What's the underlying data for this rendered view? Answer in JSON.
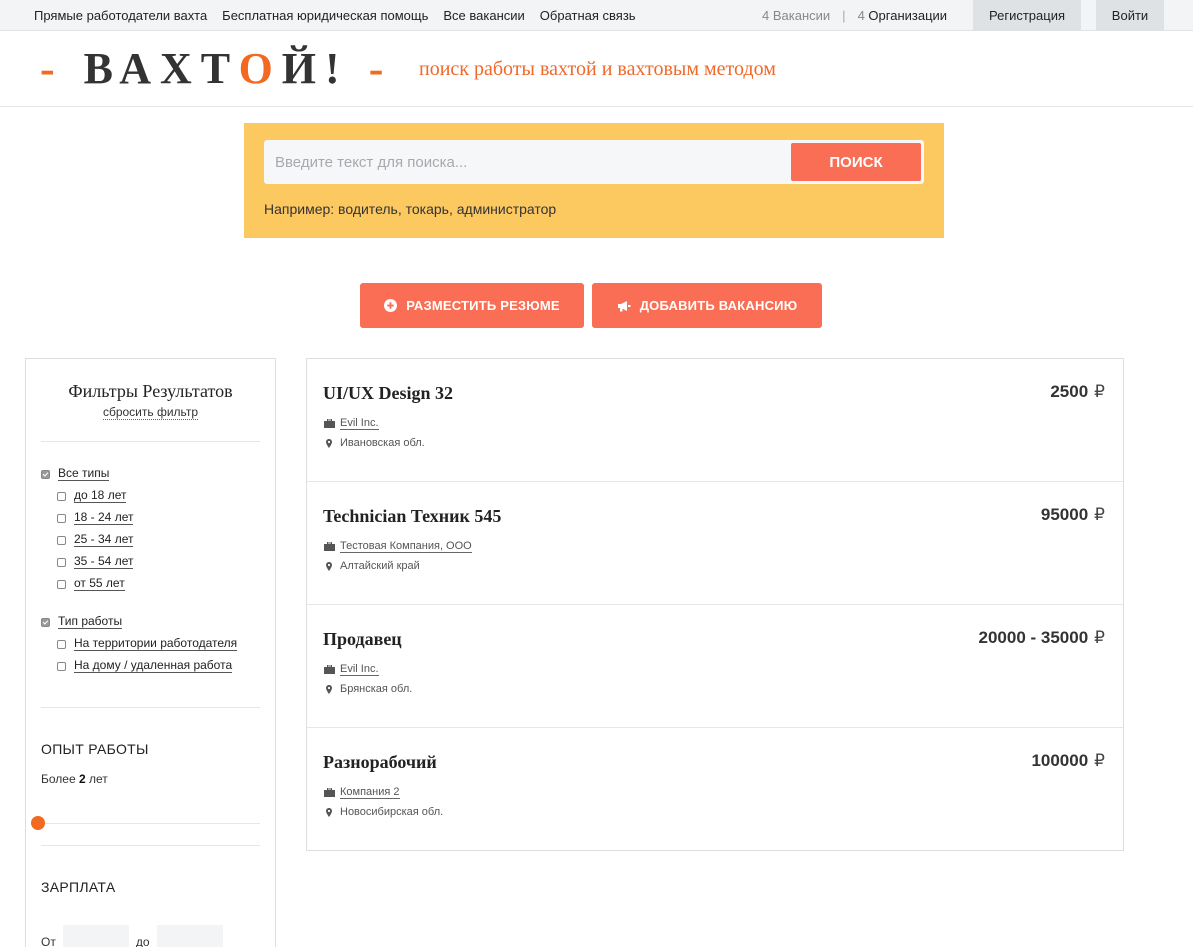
{
  "topbar": {
    "nav": [
      "Прямые работодатели вахта",
      "Бесплатная юридическая помощь",
      "Все вакансии",
      "Обратная связь"
    ],
    "vacancies_count": "4",
    "vacancies_label": "Вакансии",
    "separator": "|",
    "orgs_count": "4",
    "orgs_label": "Организации",
    "register_label": "Регистрация",
    "login_label": "Войти"
  },
  "header": {
    "logo_prefix": "-",
    "logo_part1": "ВАХТ",
    "logo_o": "О",
    "logo_part2": "Й!",
    "logo_suffix": "-",
    "tagline": "поиск работы вахтой и вахтовым методом"
  },
  "search": {
    "placeholder": "Введите текст для поиска...",
    "value": "",
    "button_label": "ПОИСК",
    "example": "Например: водитель, токарь, администратор"
  },
  "actions": {
    "resume_label": "РАЗМЕСТИТЬ РЕЗЮМЕ",
    "vacancy_label": "ДОБАВИТЬ ВАКАНСИЮ"
  },
  "filters": {
    "title": "Фильтры Результатов",
    "reset_label": "сбросить фильтр",
    "all_types_label": "Все типы",
    "all_types_checked": true,
    "age_options": [
      "до 18 лет",
      "18 - 24 лет",
      "25 - 34 лет",
      "35 - 54 лет",
      "от 55 лет"
    ],
    "work_type_label": "Тип работы",
    "work_type_checked": true,
    "work_type_options": [
      "На территории работодателя",
      "На дому / удаленная работа"
    ],
    "experience_title": "ОПЫТ РАБОТЫ",
    "experience_prefix": "Более",
    "experience_value": "2",
    "experience_suffix": "лет",
    "salary_title": "ЗАРПЛАТА",
    "salary_from_label": "От",
    "salary_to_label": "до"
  },
  "jobs": [
    {
      "title": "UI/UX Design 32",
      "salary": "2500",
      "currency": "₽",
      "company": "Evil Inc.",
      "location": "Ивановская обл."
    },
    {
      "title": "Technician Техник 545",
      "salary": "95000",
      "currency": "₽",
      "company": "Тестовая Компания, ООО",
      "location": "Алтайский край"
    },
    {
      "title": "Продавец",
      "salary": "20000 - 35000",
      "currency": "₽",
      "company": "Evil Inc.",
      "location": "Брянская обл."
    },
    {
      "title": "Разнорабочий",
      "salary": "100000",
      "currency": "₽",
      "company": "Компания 2",
      "location": "Новосибирская обл."
    }
  ],
  "colors": {
    "accent": "#fa6e55",
    "brand_orange": "#f26a21",
    "search_bg": "#fcc860"
  },
  "icons": {
    "resume": "plus-circle-icon",
    "vacancy": "megaphone-icon",
    "company": "briefcase-icon",
    "location": "map-pin-icon"
  }
}
